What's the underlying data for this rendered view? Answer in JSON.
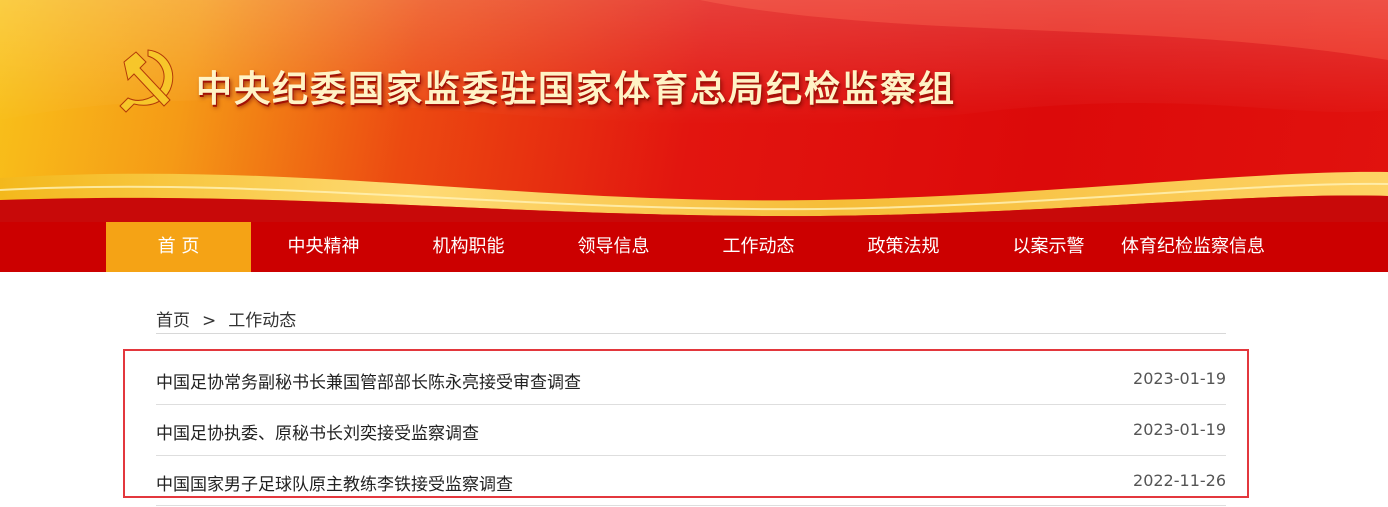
{
  "site": {
    "title": "中央纪委国家监委驻国家体育总局纪检监察组"
  },
  "nav": {
    "items": [
      {
        "label": "首 页",
        "active": true
      },
      {
        "label": "中央精神",
        "active": false
      },
      {
        "label": "机构职能",
        "active": false
      },
      {
        "label": "领导信息",
        "active": false
      },
      {
        "label": "工作动态",
        "active": false
      },
      {
        "label": "政策法规",
        "active": false
      },
      {
        "label": "以案示警",
        "active": false
      },
      {
        "label": "体育纪检监察信息",
        "active": false
      }
    ]
  },
  "breadcrumb": {
    "home": "首页",
    "separator": ">",
    "current": "工作动态"
  },
  "news": [
    {
      "title": "中国足协常务副秘书长兼国管部部长陈永亮接受审查调查",
      "date": "2023-01-19"
    },
    {
      "title": "中国足协执委、原秘书长刘奕接受监察调查",
      "date": "2023-01-19"
    },
    {
      "title": "中国国家男子足球队原主教练李铁接受监察调查",
      "date": "2022-11-26"
    }
  ],
  "colors": {
    "nav_bg": "#cc0000",
    "nav_active": "#f5a315",
    "highlight_border": "#e3373d",
    "banner_red": "#dc0a0a",
    "banner_gold": "#f9c21a"
  }
}
